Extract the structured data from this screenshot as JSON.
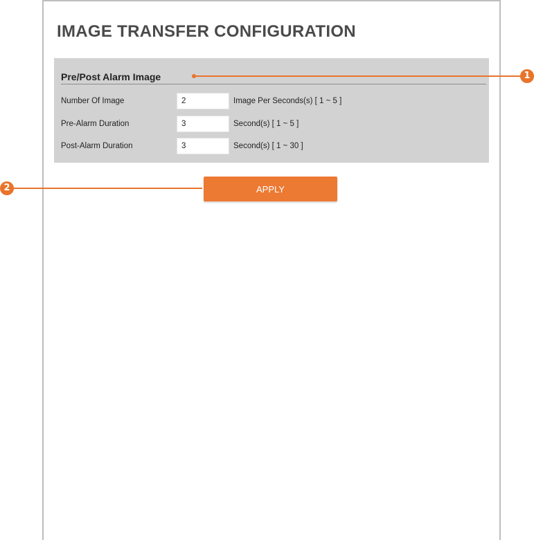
{
  "page": {
    "title": "IMAGE TRANSFER CONFIGURATION"
  },
  "section": {
    "title": "Pre/Post Alarm Image",
    "rows": [
      {
        "label": "Number Of Image",
        "value": "2",
        "hint": "Image Per Seconds(s) [ 1 ~ 5 ]"
      },
      {
        "label": "Pre-Alarm Duration",
        "value": "3",
        "hint": "Second(s) [ 1 ~ 5 ]"
      },
      {
        "label": "Post-Alarm Duration",
        "value": "3",
        "hint": "Second(s) [ 1 ~ 30 ]"
      }
    ]
  },
  "apply": {
    "label": "APPLY"
  },
  "callouts": {
    "one": "1",
    "two": "2"
  },
  "colors": {
    "accent": "#e8742b",
    "panel": "#d2d2d2",
    "title": "#4a4a4a"
  }
}
